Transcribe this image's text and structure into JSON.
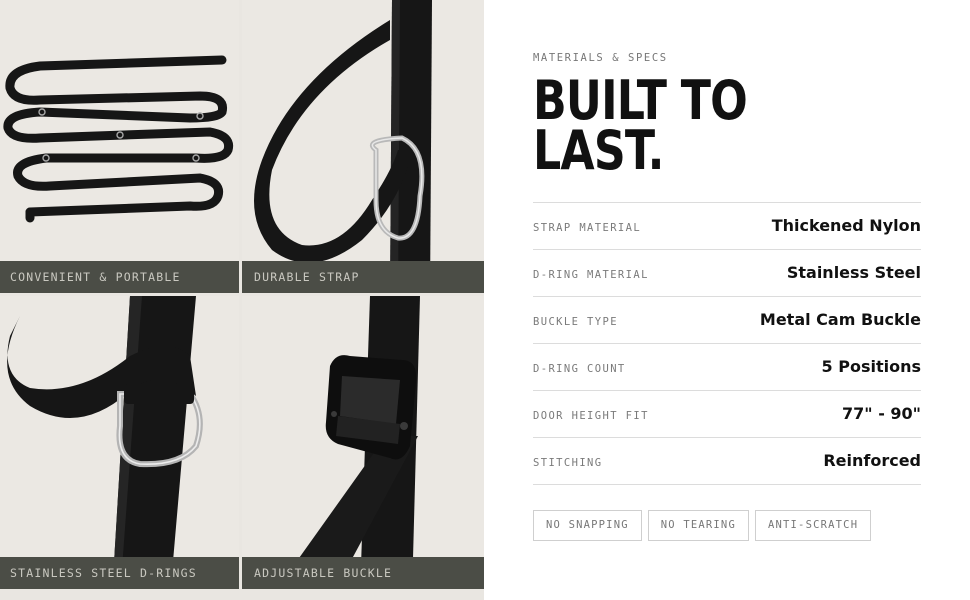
{
  "panels": [
    {
      "caption": "CONVENIENT & PORTABLE",
      "image": "coiled-strap"
    },
    {
      "caption": "DURABLE STRAP",
      "image": "strap-loop-d-ring"
    },
    {
      "caption": "STAINLESS STEEL D-RINGS",
      "image": "strap-d-ring-closeup"
    },
    {
      "caption": "ADJUSTABLE BUCKLE",
      "image": "cam-buckle"
    }
  ],
  "specs_section": {
    "eyebrow": "MATERIALS & SPECS",
    "headline": "BUILT TO\nLAST.",
    "rows": [
      {
        "label": "STRAP MATERIAL",
        "value": "Thickened Nylon"
      },
      {
        "label": "D-RING MATERIAL",
        "value": "Stainless Steel"
      },
      {
        "label": "BUCKLE TYPE",
        "value": "Metal Cam Buckle"
      },
      {
        "label": "D-RING COUNT",
        "value": "5 Positions"
      },
      {
        "label": "DOOR HEIGHT FIT",
        "value": "77\" - 90\""
      },
      {
        "label": "STITCHING",
        "value": "Reinforced"
      }
    ],
    "tags": [
      "NO SNAPPING",
      "NO TEARING",
      "ANTI-SCRATCH"
    ]
  },
  "colors": {
    "caption_bar": "#4b4d46",
    "photo_background": "#ebe8e3",
    "strap": "#161616"
  }
}
